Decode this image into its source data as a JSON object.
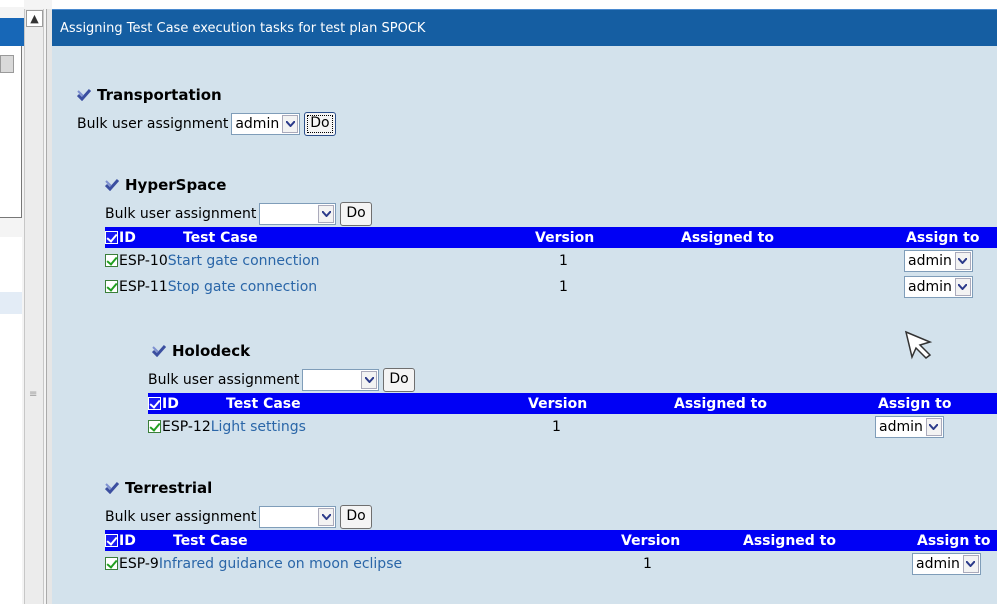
{
  "page_title": "Assigning Test Case execution tasks for test plan SPOCK",
  "sections": {
    "transportation": {
      "title": "Transportation",
      "bulk_label": "Bulk user assignment",
      "bulk_value": "admin",
      "do_label": "Do"
    },
    "hyperspace": {
      "title": "HyperSpace",
      "bulk_label": "Bulk user assignment",
      "bulk_value": "",
      "do_label": "Do",
      "headers": {
        "id": "ID",
        "test_case": "Test Case",
        "version": "Version",
        "assigned_to": "Assigned to",
        "assign_to": "Assign to"
      },
      "rows": [
        {
          "id": "ESP-10",
          "name": "Start gate connection",
          "version": "1",
          "assigned": "",
          "assign": "admin"
        },
        {
          "id": "ESP-11",
          "name": "Stop gate connection",
          "version": "1",
          "assigned": "",
          "assign": "admin"
        }
      ]
    },
    "holodeck": {
      "title": "Holodeck",
      "bulk_label": "Bulk user assignment",
      "bulk_value": "",
      "do_label": "Do",
      "headers": {
        "id": "ID",
        "test_case": "Test Case",
        "version": "Version",
        "assigned_to": "Assigned to",
        "assign_to": "Assign to"
      },
      "rows": [
        {
          "id": "ESP-12",
          "name": "Light settings",
          "version": "1",
          "assigned": "",
          "assign": "admin"
        }
      ]
    },
    "terrestrial": {
      "title": "Terrestrial",
      "bulk_label": "Bulk user assignment",
      "bulk_value": "",
      "do_label": "Do",
      "headers": {
        "id": "ID",
        "test_case": "Test Case",
        "version": "Version",
        "assigned_to": "Assigned to",
        "assign_to": "Assign to"
      },
      "rows": [
        {
          "id": "ESP-9",
          "name": "Infrared guidance on moon eclipse",
          "version": "1",
          "assigned": "",
          "assign": "admin"
        }
      ]
    }
  },
  "colors": {
    "title_bar": "#155ea2",
    "content_bg": "#d3e2ec",
    "table_header": "#0000f5",
    "link": "#2a66a8"
  }
}
